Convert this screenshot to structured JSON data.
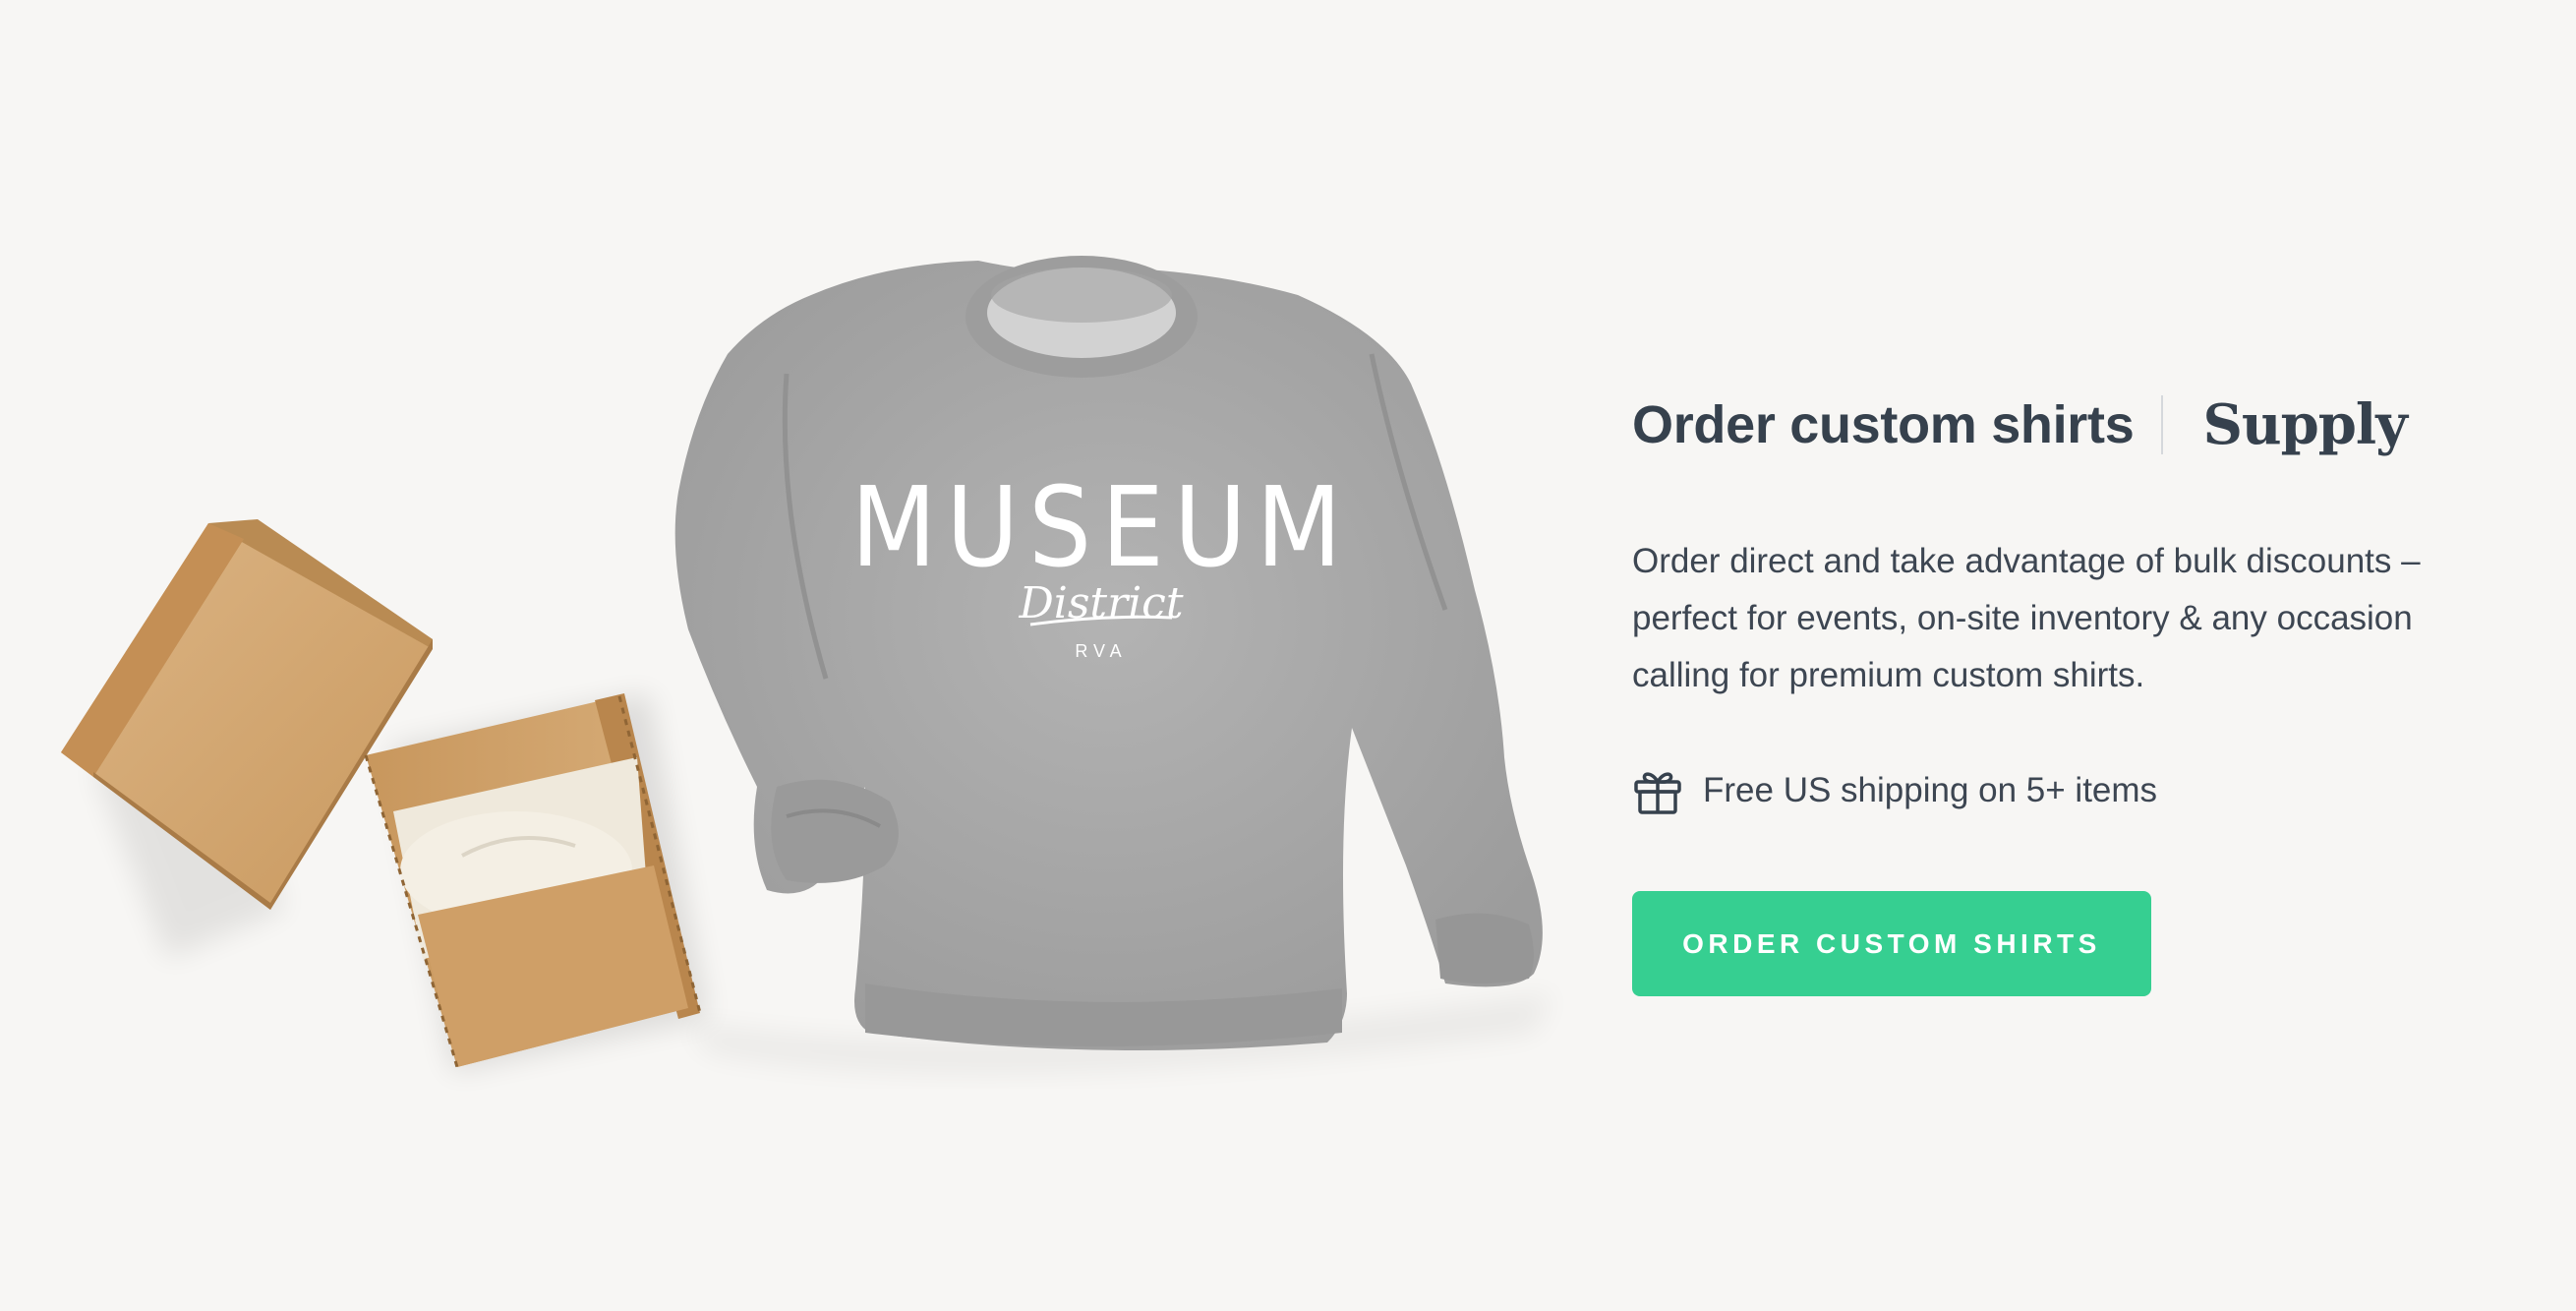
{
  "header": {
    "title": "Order custom shirts",
    "brand": "Supply"
  },
  "body": {
    "description": "Order direct and take advantage of bulk discounts – perfect for events, on-site inventory & any occasion calling for premium custom shirts."
  },
  "shipping": {
    "icon": "gift-icon",
    "text": "Free US shipping on 5+ items"
  },
  "cta": {
    "label": "ORDER CUSTOM SHIRTS"
  },
  "image": {
    "print": {
      "line1": "MUSEUM",
      "line2": "District",
      "line3": "RVA"
    }
  },
  "colors": {
    "background": "#f7f6f4",
    "text": "#36414d",
    "accent": "#36cf91",
    "sweatshirt": "#a7a7a7",
    "cardboard": "#d3a877"
  }
}
